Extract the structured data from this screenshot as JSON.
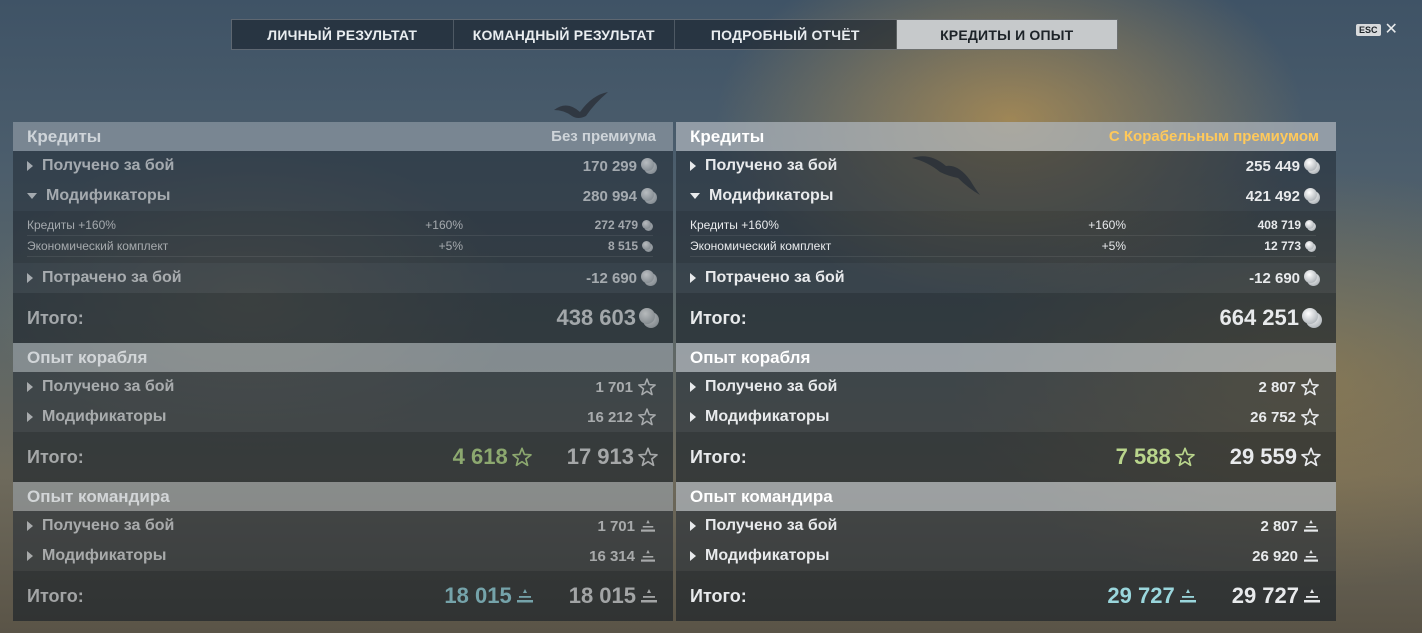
{
  "tabs": [
    {
      "label": "ЛИЧНЫЙ РЕЗУЛЬТАТ",
      "active": false
    },
    {
      "label": "КОМАНДНЫЙ РЕЗУЛЬТАТ",
      "active": false
    },
    {
      "label": "ПОДРОБНЫЙ ОТЧЁТ",
      "active": false
    },
    {
      "label": "КРЕДИТЫ И ОПЫТ",
      "active": true
    }
  ],
  "esc": {
    "label": "ESC",
    "close": "✕"
  },
  "left": {
    "credits": {
      "title": "Кредиты",
      "badge": "Без премиума",
      "earned": {
        "label": "Получено за бой",
        "value": "170 299"
      },
      "modifiers": {
        "label": "Модификаторы",
        "value": "280 994"
      },
      "sub": [
        {
          "name": "Кредиты +160%",
          "pct": "+160%",
          "value": "272 479"
        },
        {
          "name": "Экономический комплект",
          "pct": "+5%",
          "value": "8 515"
        }
      ],
      "spent": {
        "label": "Потрачено за бой",
        "value": "-12 690"
      },
      "total": {
        "label": "Итого:",
        "value": "438 603"
      }
    },
    "ship_xp": {
      "title": "Опыт корабля",
      "earned": {
        "label": "Получено за бой",
        "value": "1 701"
      },
      "modifiers": {
        "label": "Модификаторы",
        "value": "16 212"
      },
      "total": {
        "label": "Итого:",
        "free": "4 618",
        "value": "17 913"
      }
    },
    "cmdr_xp": {
      "title": "Опыт командира",
      "earned": {
        "label": "Получено за бой",
        "value": "1 701"
      },
      "modifiers": {
        "label": "Модификаторы",
        "value": "16 314"
      },
      "total": {
        "label": "Итого:",
        "free": "18 015",
        "value": "18 015"
      }
    }
  },
  "right": {
    "credits": {
      "title": "Кредиты",
      "badge": "С Корабельным премиумом",
      "earned": {
        "label": "Получено за бой",
        "value": "255 449"
      },
      "modifiers": {
        "label": "Модификаторы",
        "value": "421 492"
      },
      "sub": [
        {
          "name": "Кредиты +160%",
          "pct": "+160%",
          "value": "408 719"
        },
        {
          "name": "Экономический комплект",
          "pct": "+5%",
          "value": "12 773"
        }
      ],
      "spent": {
        "label": "Потрачено за бой",
        "value": "-12 690"
      },
      "total": {
        "label": "Итого:",
        "value": "664 251"
      }
    },
    "ship_xp": {
      "title": "Опыт корабля",
      "earned": {
        "label": "Получено за бой",
        "value": "2 807"
      },
      "modifiers": {
        "label": "Модификаторы",
        "value": "26 752"
      },
      "total": {
        "label": "Итого:",
        "free": "7 588",
        "value": "29 559"
      }
    },
    "cmdr_xp": {
      "title": "Опыт командира",
      "earned": {
        "label": "Получено за бой",
        "value": "2 807"
      },
      "modifiers": {
        "label": "Модификаторы",
        "value": "26 920"
      },
      "total": {
        "label": "Итого:",
        "free": "29 727",
        "value": "29 727"
      }
    }
  },
  "colors": {
    "premium_badge": "#ffc95a",
    "free_xp": "#b9d58c",
    "commander_xp": "#9ad6dc",
    "active_tab": "#c6c9cb"
  },
  "icons": {
    "credits": "coin-stack-icon",
    "ship_xp": "star-icon",
    "commander_xp": "commander-rank-icon",
    "expand": "triangle-right-icon",
    "collapse": "triangle-down-icon"
  }
}
